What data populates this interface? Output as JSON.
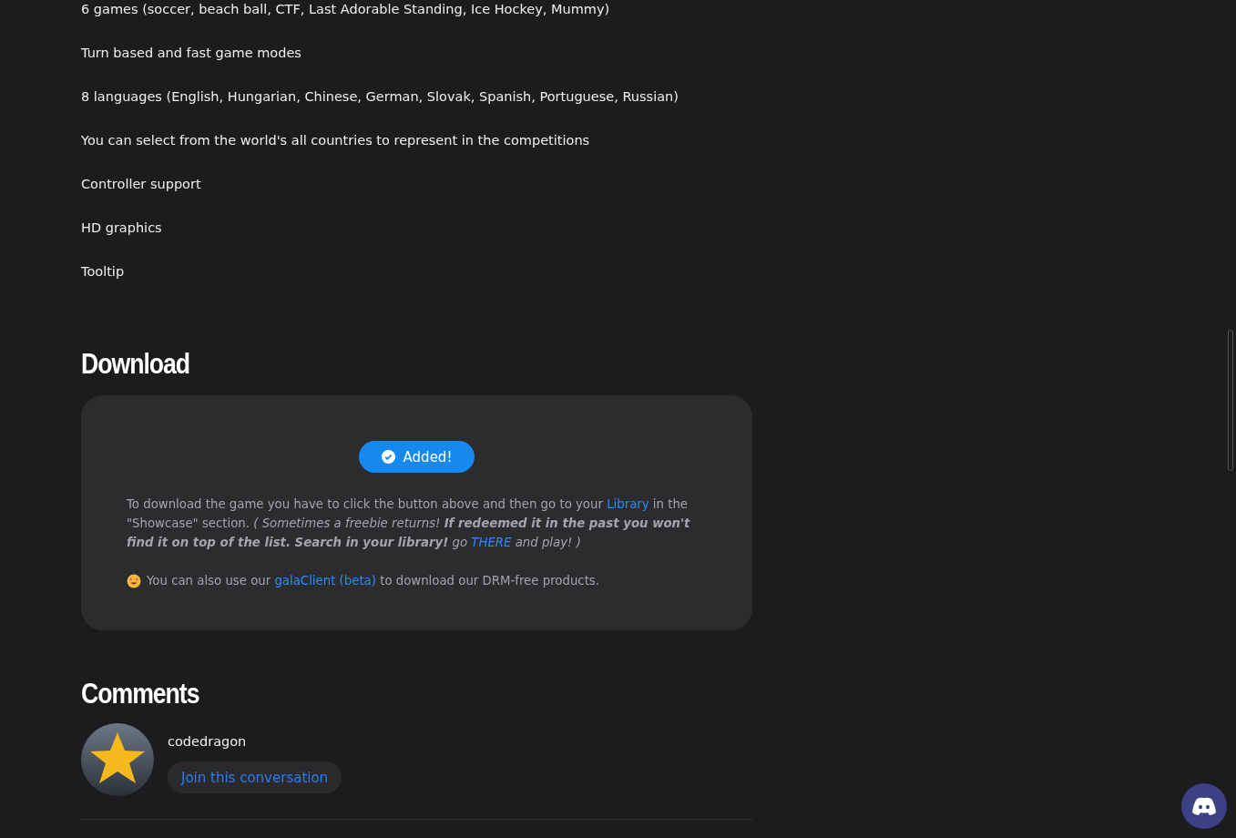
{
  "features": [
    "6 games (soccer, beach ball, CTF, Last Adorable Standing, Ice Hockey, Mummy)",
    "Turn based and fast game modes",
    "8 languages (English, Hungarian, Chinese, German, Slovak, Spanish, Portuguese, Russian)",
    "You can select from the world's all countries to represent in the competitions",
    "Controller support",
    "HD graphics",
    "Tooltip"
  ],
  "download": {
    "title": "Download",
    "button": {
      "label": "Added!",
      "added": true
    },
    "instructions": [
      {
        "kind": "text",
        "text": "To download the game you have to click the button above and then go to your "
      },
      {
        "kind": "link",
        "text": "Library"
      },
      {
        "kind": "text",
        "text": " in the \"Showcase\" section. "
      },
      {
        "kind": "text",
        "italic": true,
        "text": "( Sometimes a freebie returns! **If redeemed it in the past you won't find it on top of the list. Search in your library!** go "
      },
      {
        "kind": "link",
        "italic": true,
        "text": "THERE"
      },
      {
        "kind": "text",
        "italic": true,
        "text": " and play! )"
      }
    ],
    "client_note": [
      {
        "kind": "text",
        "text": "You can also use our "
      },
      {
        "kind": "link",
        "text": "galaClient (beta)"
      },
      {
        "kind": "text",
        "text": " to download our DRM-free products."
      }
    ]
  },
  "comments": {
    "title": "Comments",
    "user": "codedragon",
    "join_button": "Join this conversation"
  }
}
